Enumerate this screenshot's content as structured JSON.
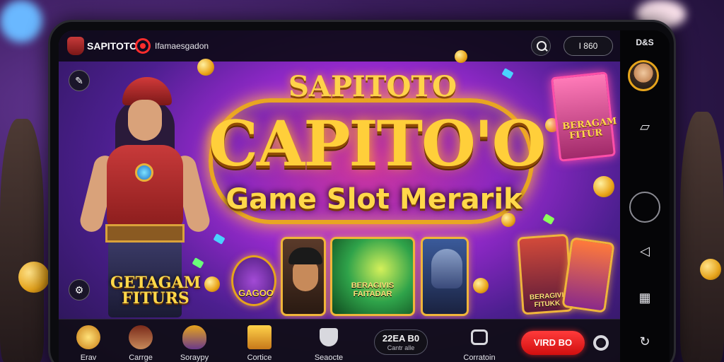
{
  "device": {
    "side_panel": {
      "time": "D&S"
    }
  },
  "topbar": {
    "brand": "SAPITOTO",
    "link": "Ifamaesgadon",
    "balance": "I 860"
  },
  "hero": {
    "title_small": "SAPITOTO",
    "title_large": "CAPITO'O",
    "subtitle": "Game Slot Merarik",
    "badge": "GETAGAM FITURS",
    "emblem_label": "GAGOO",
    "poster": "BERAGAM FITUR",
    "cards": [
      {
        "label": ""
      },
      {
        "label": "BERAGIVIS FAITADAR"
      },
      {
        "label": ""
      },
      {
        "label": "BERAGIVI FITUKK"
      },
      {
        "label": ""
      }
    ]
  },
  "bottom_nav": {
    "items": [
      {
        "label": "Erav"
      },
      {
        "label": "Carrge"
      },
      {
        "label": "Soraypy"
      },
      {
        "label": "Cortice"
      },
      {
        "label": "Seaocte"
      },
      {
        "label": "Corratoin"
      }
    ],
    "counter": {
      "value": "22EA B0",
      "caption": "Cantr alle"
    },
    "cta": "VIRD BO"
  },
  "colors": {
    "accent_gold": "#ffcf3a",
    "cta_red": "#e01818",
    "screen_purple": "#a12bd6"
  }
}
